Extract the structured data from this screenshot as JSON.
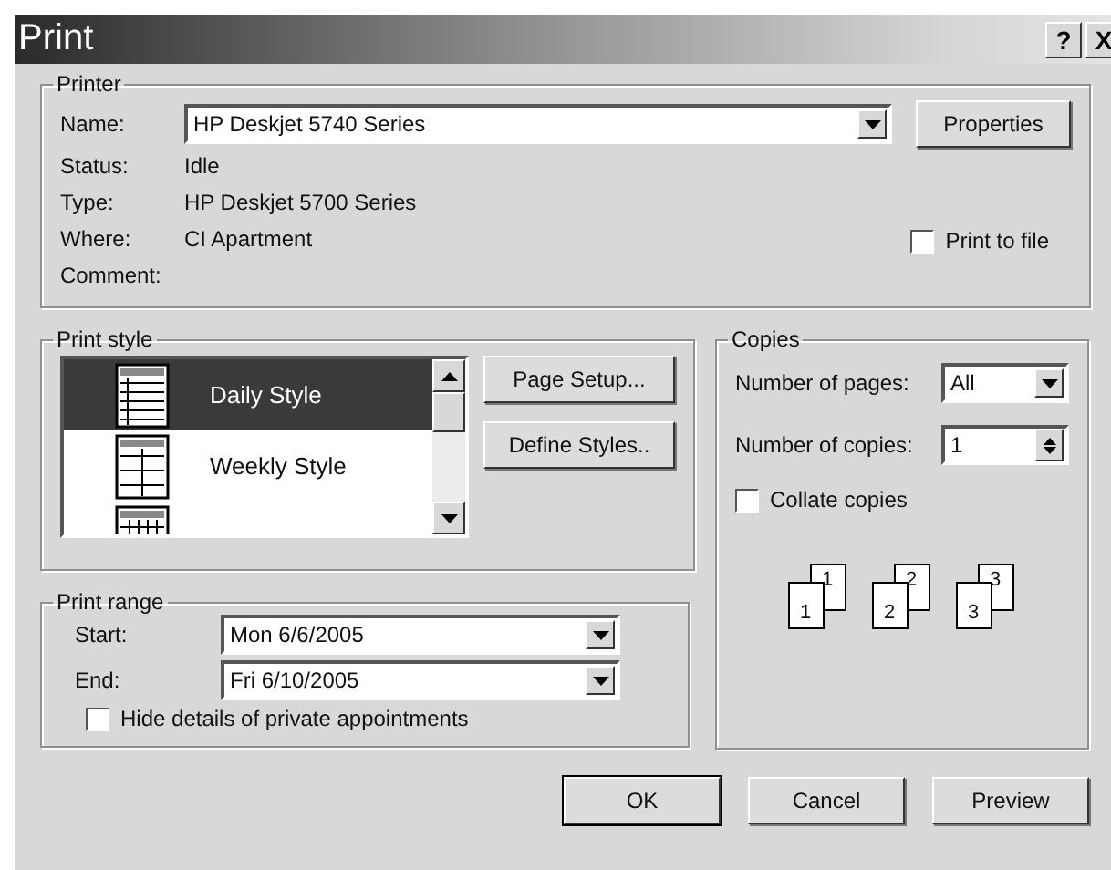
{
  "window": {
    "title": "Print",
    "help_button": "?",
    "close_button": "X"
  },
  "printer": {
    "legend": "Printer",
    "name_label": "Name:",
    "name_value": "HP Deskjet 5740 Series",
    "properties_button": "Properties",
    "info": [
      {
        "label": "Status:",
        "value": "Idle"
      },
      {
        "label": "Type:",
        "value": "HP Deskjet 5700 Series"
      },
      {
        "label": "Where:",
        "value": "CI Apartment"
      },
      {
        "label": "Comment:"
      }
    ],
    "print_to_file": {
      "label": "Print to file",
      "checked": false
    }
  },
  "print_style": {
    "legend": "Print style",
    "styles": [
      {
        "label": "Daily Style",
        "kind": "daily",
        "selected": true
      },
      {
        "label": "Weekly Style",
        "kind": "weekly",
        "selected": false
      },
      {
        "kind": "monthly",
        "selected": false
      }
    ],
    "buttons": [
      "Page Setup...",
      "Define Styles.."
    ]
  },
  "print_range": {
    "legend": "Print range",
    "start": {
      "label": "Start:",
      "value": "Mon 6/6/2005"
    },
    "end": {
      "label": "End:",
      "value": "Fri 6/10/2005"
    },
    "hide_private": {
      "label": "Hide details of private appointments",
      "checked": false
    }
  },
  "copies": {
    "legend": "Copies",
    "pages_label": "Number of pages:",
    "pages_value": "All",
    "copies_label": "Number of copies:",
    "copies_value": "1",
    "collate": {
      "label": "Collate copies",
      "checked": false
    },
    "collate_sets": [
      {
        "front": "1",
        "back": "1"
      },
      {
        "front": "2",
        "back": "2"
      },
      {
        "front": "3",
        "back": "3"
      }
    ]
  },
  "buttons": [
    "OK",
    "Cancel",
    "Preview"
  ]
}
